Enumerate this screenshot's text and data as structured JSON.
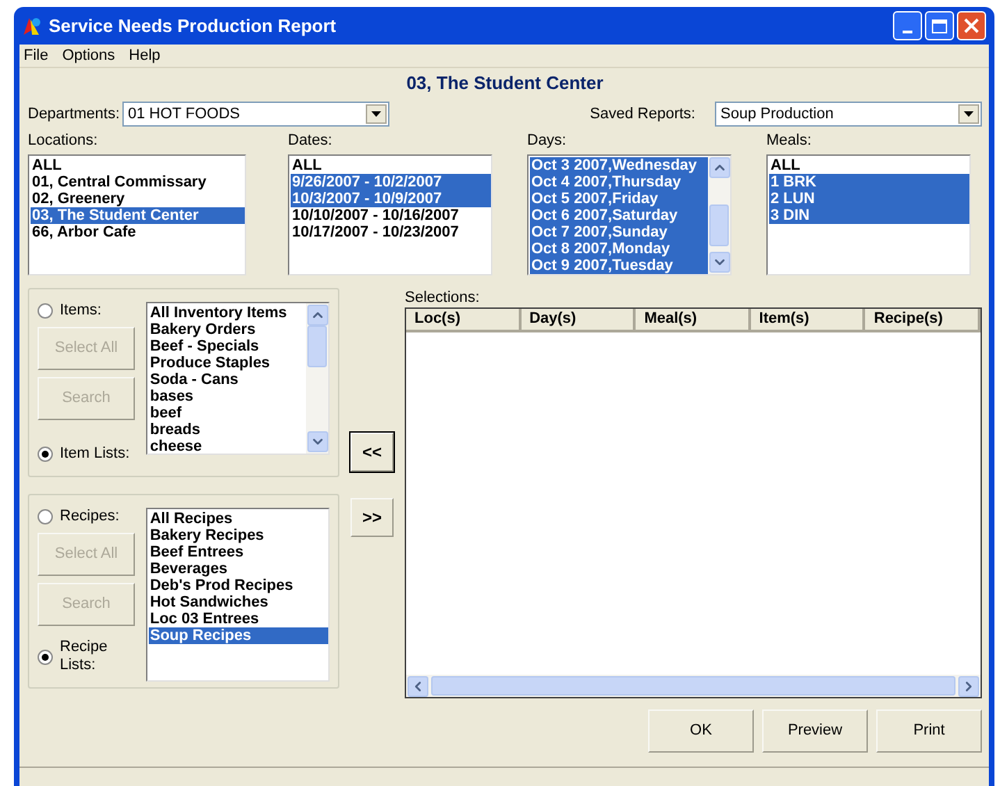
{
  "window": {
    "title": "Service Needs Production Report"
  },
  "menu": [
    "File",
    "Options",
    "Help"
  ],
  "header": "03, The Student Center",
  "departments": {
    "label": "Departments:",
    "value": "01 HOT FOODS"
  },
  "saved_reports": {
    "label": "Saved Reports:",
    "value": "Soup Production"
  },
  "lists": [
    {
      "label": "Locations:",
      "scrollbar": false,
      "items": [
        {
          "text": "ALL",
          "selected": false
        },
        {
          "text": "01, Central Commissary",
          "selected": false
        },
        {
          "text": "02, Greenery",
          "selected": false
        },
        {
          "text": "03, The Student Center",
          "selected": true
        },
        {
          "text": "66, Arbor Cafe",
          "selected": false
        }
      ]
    },
    {
      "label": "Dates:",
      "scrollbar": false,
      "items": [
        {
          "text": "ALL",
          "selected": false
        },
        {
          "text": "9/26/2007 - 10/2/2007",
          "selected": true
        },
        {
          "text": "10/3/2007 - 10/9/2007",
          "selected": true
        },
        {
          "text": "10/10/2007 - 10/16/2007",
          "selected": false
        },
        {
          "text": "10/17/2007 - 10/23/2007",
          "selected": false
        }
      ]
    },
    {
      "label": "Days:",
      "scrollbar": true,
      "items": [
        {
          "text": "Oct 3 2007,Wednesday",
          "selected": true
        },
        {
          "text": "Oct 4 2007,Thursday",
          "selected": true
        },
        {
          "text": "Oct 5 2007,Friday",
          "selected": true
        },
        {
          "text": "Oct 6 2007,Saturday",
          "selected": true
        },
        {
          "text": "Oct 7 2007,Sunday",
          "selected": true
        },
        {
          "text": "Oct 8 2007,Monday",
          "selected": true
        },
        {
          "text": "Oct 9 2007,Tuesday",
          "selected": true
        }
      ]
    },
    {
      "label": "Meals:",
      "scrollbar": false,
      "items": [
        {
          "text": "ALL",
          "selected": false
        },
        {
          "text": "1 BRK",
          "selected": true
        },
        {
          "text": "2 LUN",
          "selected": true
        },
        {
          "text": "3 DIN",
          "selected": true
        }
      ]
    }
  ],
  "groups": [
    {
      "radios": [
        {
          "label": "Items:",
          "selected": false
        },
        {
          "label": "Item Lists:",
          "selected": true
        }
      ],
      "buttons": [
        {
          "label": "Select All",
          "disabled": true
        },
        {
          "label": "Search",
          "disabled": true
        }
      ],
      "scrollbar": true,
      "items": [
        {
          "text": "All Inventory Items",
          "selected": false
        },
        {
          "text": "Bakery Orders",
          "selected": false
        },
        {
          "text": "Beef - Specials",
          "selected": false
        },
        {
          "text": "Produce Staples",
          "selected": false
        },
        {
          "text": "Soda - Cans",
          "selected": false
        },
        {
          "text": "bases",
          "selected": false
        },
        {
          "text": "beef",
          "selected": false
        },
        {
          "text": "breads",
          "selected": false
        },
        {
          "text": "cheese",
          "selected": false
        }
      ]
    },
    {
      "radios": [
        {
          "label": "Recipes:",
          "selected": false
        },
        {
          "label": "Recipe Lists:",
          "selected": true
        }
      ],
      "buttons": [
        {
          "label": "Select All",
          "disabled": true
        },
        {
          "label": "Search",
          "disabled": true
        }
      ],
      "scrollbar": false,
      "items": [
        {
          "text": "All Recipes",
          "selected": false
        },
        {
          "text": "Bakery Recipes",
          "selected": false
        },
        {
          "text": "Beef Entrees",
          "selected": false
        },
        {
          "text": "Beverages",
          "selected": false
        },
        {
          "text": "Deb's Prod Recipes",
          "selected": false
        },
        {
          "text": "Hot Sandwiches",
          "selected": false
        },
        {
          "text": "Loc 03 Entrees",
          "selected": false
        },
        {
          "text": "Soup Recipes",
          "selected": true
        }
      ]
    }
  ],
  "transfer_buttons": [
    "<<",
    ">>"
  ],
  "selections": {
    "label": "Selections:",
    "columns": [
      "Loc(s)",
      "Day(s)",
      "Meal(s)",
      "Item(s)",
      "Recipe(s)"
    ]
  },
  "buttons": [
    "OK",
    "Preview",
    "Print"
  ]
}
